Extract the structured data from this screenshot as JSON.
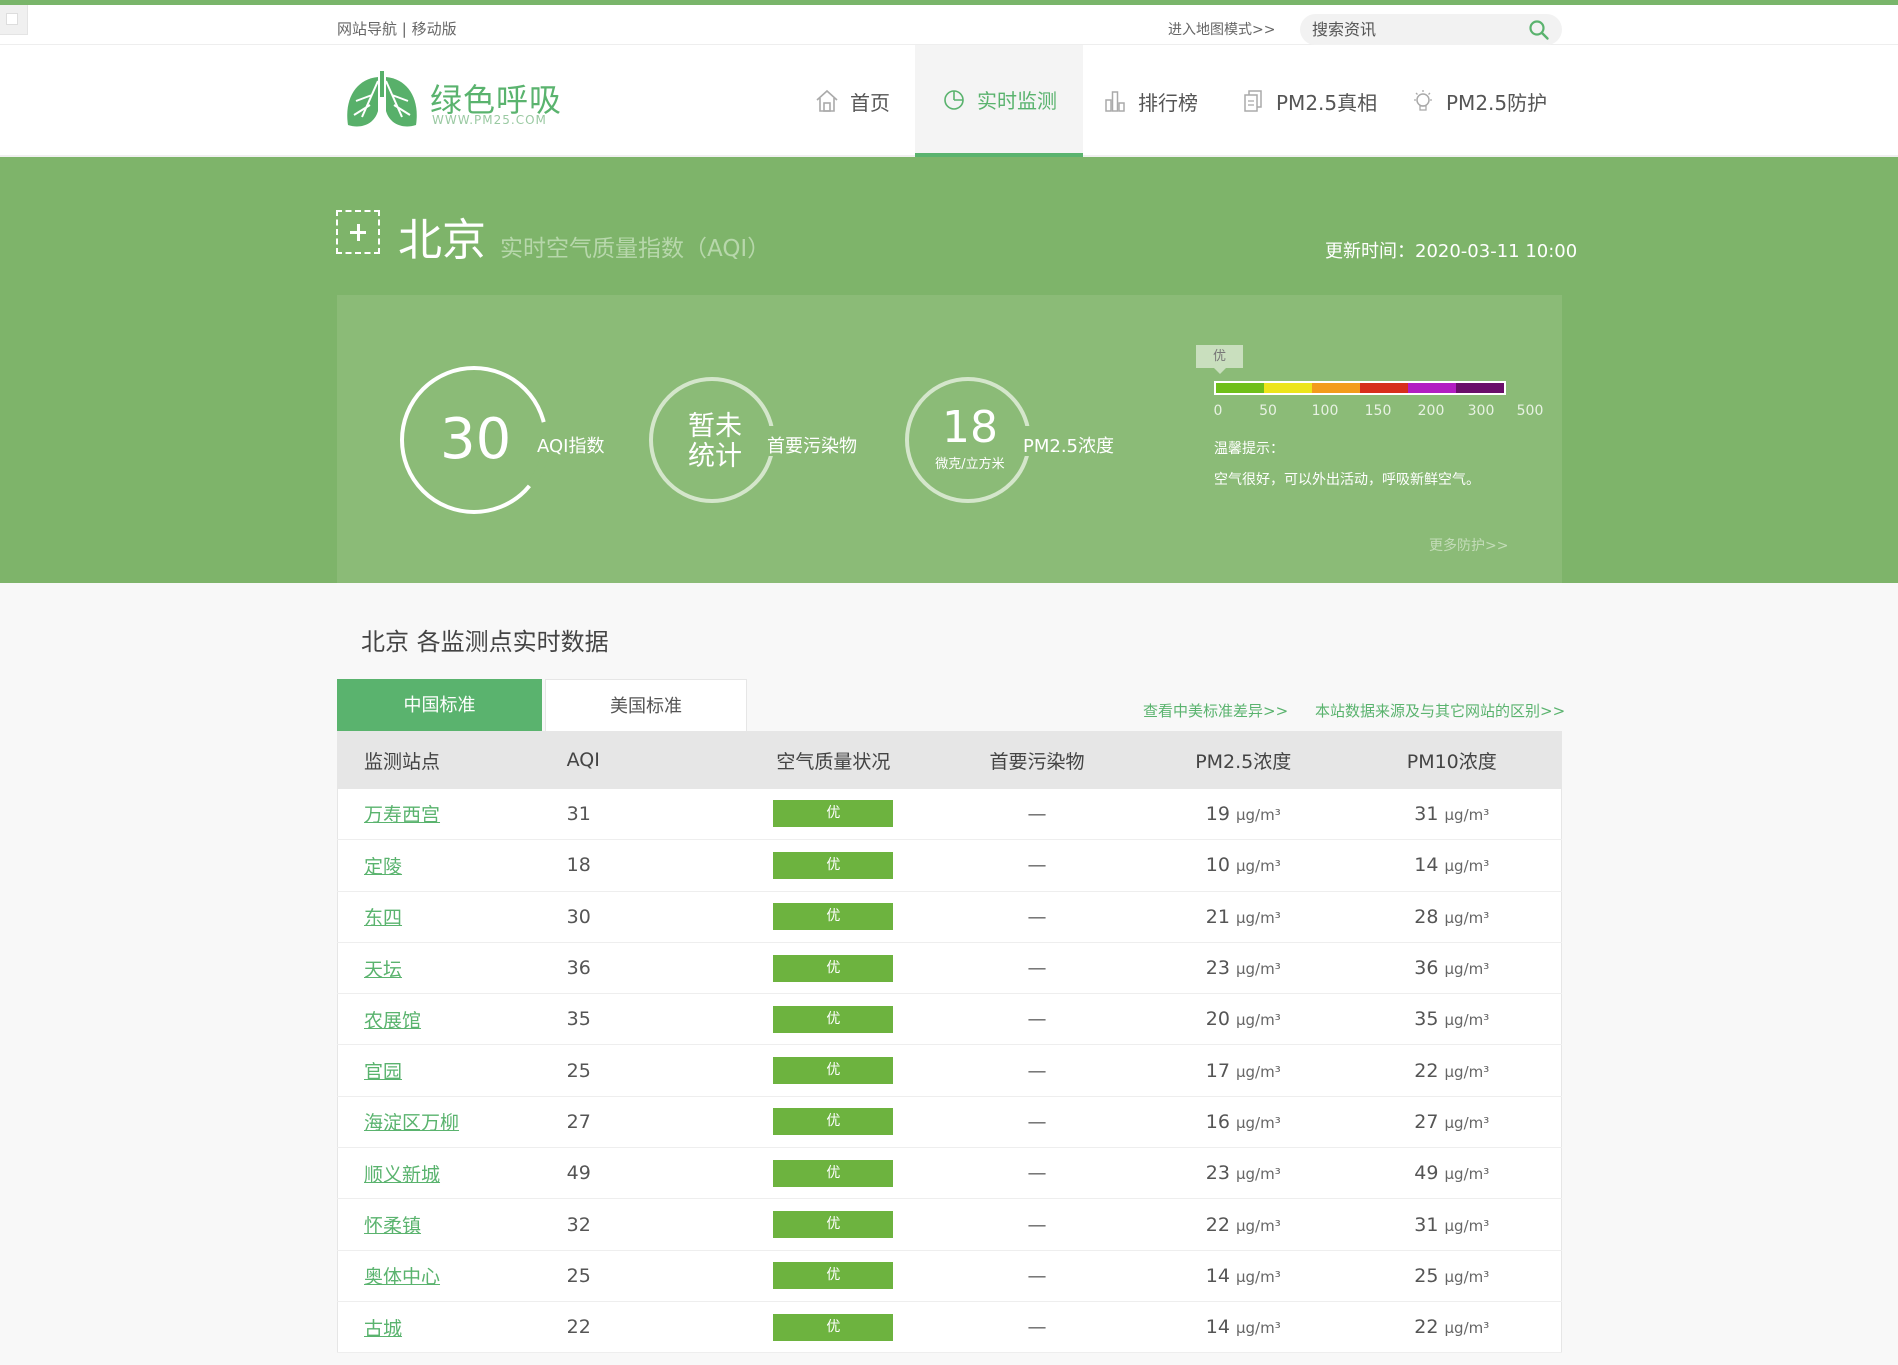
{
  "topbar": {
    "nav_link": "网站导航",
    "separator": "|",
    "mobile_link": "移动版",
    "map_mode": "进入地图模式>>",
    "search_placeholder": "搜索资讯"
  },
  "logo": {
    "name": "绿色呼吸",
    "url_text": "WWW.PM25.COM"
  },
  "nav": [
    {
      "label": "首页",
      "icon": "home-icon"
    },
    {
      "label": "实时监测",
      "icon": "pie-chart-icon",
      "active": true
    },
    {
      "label": "排行榜",
      "icon": "bar-chart-icon"
    },
    {
      "label": "PM2.5真相",
      "icon": "document-icon"
    },
    {
      "label": "PM2.5防护",
      "icon": "lightbulb-icon"
    }
  ],
  "hero": {
    "city": "北京",
    "subtitle": "实时空气质量指数（AQI）",
    "update_time": "更新时间：2020-03-11 10:00",
    "aqi": {
      "value": "30",
      "label": "AQI指数",
      "fraction": 0.06
    },
    "pollutant": {
      "value": "暂未统计",
      "label": "首要污染物"
    },
    "pm25": {
      "value": "18",
      "unit": "微克/立方米",
      "label": "PM2.5浓度"
    },
    "level": "优",
    "scale_colors": [
      "#6fbf1a",
      "#ede51b",
      "#f39c1c",
      "#d72f1c",
      "#b21ec2",
      "#6a0f6a"
    ],
    "scale_labels": [
      "0",
      "50",
      "100",
      "150",
      "200",
      "300",
      "500"
    ],
    "tip_title": "温馨提示：",
    "tip_text": "空气很好，可以外出活动，呼吸新鲜空气。",
    "more_link": "更多防护>>"
  },
  "section": {
    "title": "北京 各监测点实时数据",
    "tab_cn": "中国标准",
    "tab_us": "美国标准",
    "link_diff": "查看中美标准差异>>",
    "link_source": "本站数据来源及与其它网站的区别>>"
  },
  "table": {
    "headers": [
      "监测站点",
      "AQI",
      "空气质量状况",
      "首要污染物",
      "PM2.5浓度",
      "PM10浓度"
    ],
    "unit": "μg/m³",
    "rows": [
      {
        "station": "万寿西宫",
        "aqi": "31",
        "quality": "优",
        "pollutant": "—",
        "pm25": "19",
        "pm10": "31"
      },
      {
        "station": "定陵",
        "aqi": "18",
        "quality": "优",
        "pollutant": "—",
        "pm25": "10",
        "pm10": "14"
      },
      {
        "station": "东四",
        "aqi": "30",
        "quality": "优",
        "pollutant": "—",
        "pm25": "21",
        "pm10": "28"
      },
      {
        "station": "天坛",
        "aqi": "36",
        "quality": "优",
        "pollutant": "—",
        "pm25": "23",
        "pm10": "36"
      },
      {
        "station": "农展馆",
        "aqi": "35",
        "quality": "优",
        "pollutant": "—",
        "pm25": "20",
        "pm10": "35"
      },
      {
        "station": "官园",
        "aqi": "25",
        "quality": "优",
        "pollutant": "—",
        "pm25": "17",
        "pm10": "22"
      },
      {
        "station": "海淀区万柳",
        "aqi": "27",
        "quality": "优",
        "pollutant": "—",
        "pm25": "16",
        "pm10": "27"
      },
      {
        "station": "顺义新城",
        "aqi": "49",
        "quality": "优",
        "pollutant": "—",
        "pm25": "23",
        "pm10": "49"
      },
      {
        "station": "怀柔镇",
        "aqi": "32",
        "quality": "优",
        "pollutant": "—",
        "pm25": "22",
        "pm10": "31"
      },
      {
        "station": "奥体中心",
        "aqi": "25",
        "quality": "优",
        "pollutant": "—",
        "pm25": "14",
        "pm10": "25"
      },
      {
        "station": "古城",
        "aqi": "22",
        "quality": "优",
        "pollutant": "—",
        "pm25": "14",
        "pm10": "22"
      }
    ]
  },
  "colors": {
    "brand_green": "#5ab36e",
    "hero_bg": "#7eb46a",
    "panel_bg": "#8bbb77",
    "badge_green": "#6db33f"
  }
}
